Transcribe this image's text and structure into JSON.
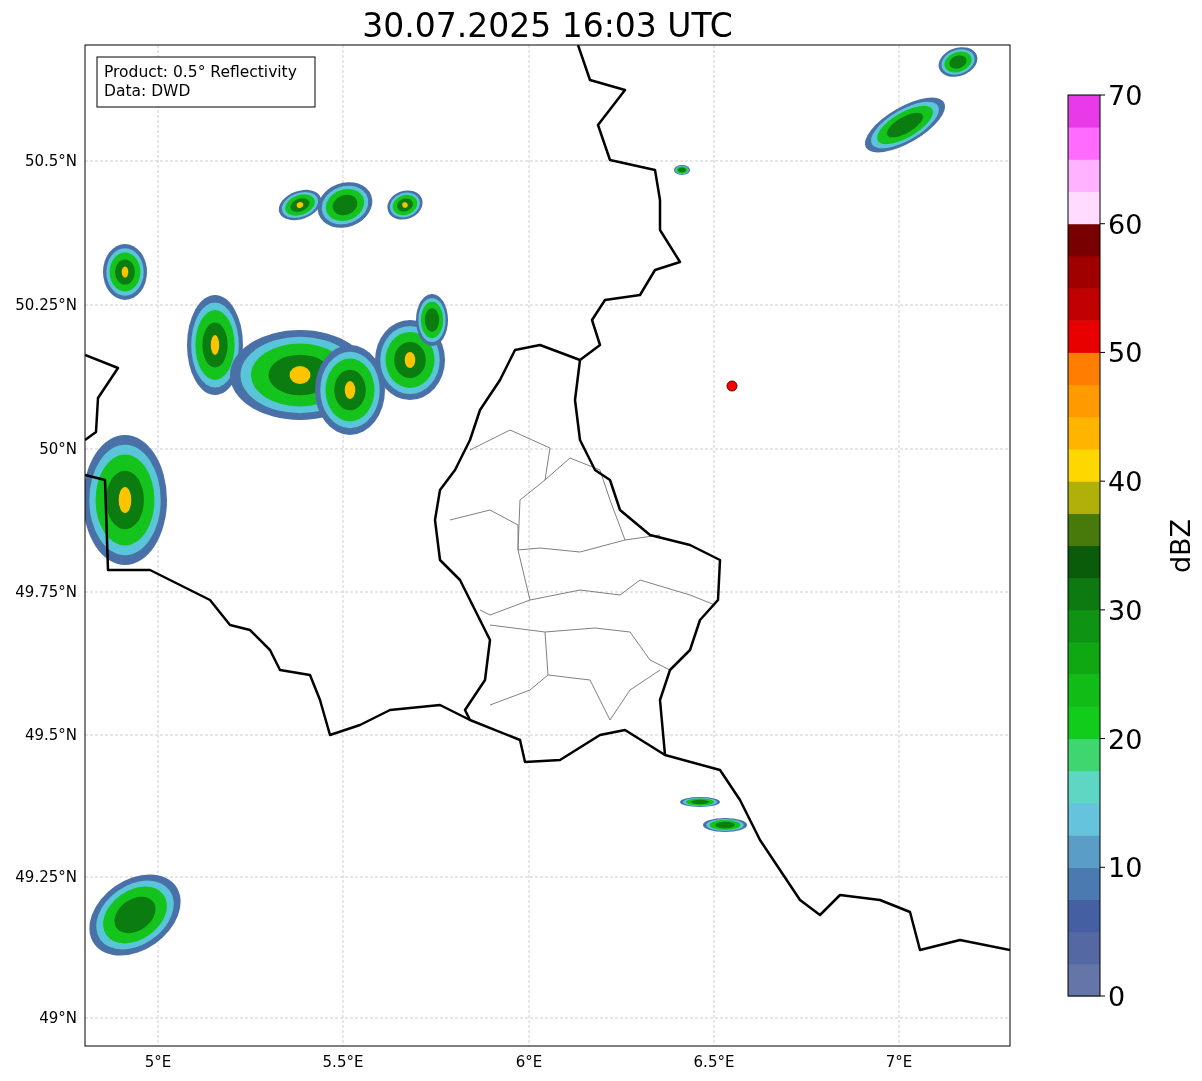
{
  "title": "30.07.2025 16:03 UTC",
  "info_box": [
    "Product: 0.5° Reflectivity",
    "Data: DWD"
  ],
  "map": {
    "x_tick_labels": [
      "5°E",
      "5.5°E",
      "6°E",
      "6.5°E",
      "7°E"
    ],
    "y_tick_labels": [
      "50.5°N",
      "50.25°N",
      "50°N",
      "49.75°N",
      "49.5°N",
      "49.25°N",
      "49°N"
    ]
  },
  "colorbar": {
    "label": "dBZ",
    "tick_labels": [
      "70",
      "60",
      "50",
      "40",
      "30",
      "20",
      "10",
      "0"
    ]
  }
}
